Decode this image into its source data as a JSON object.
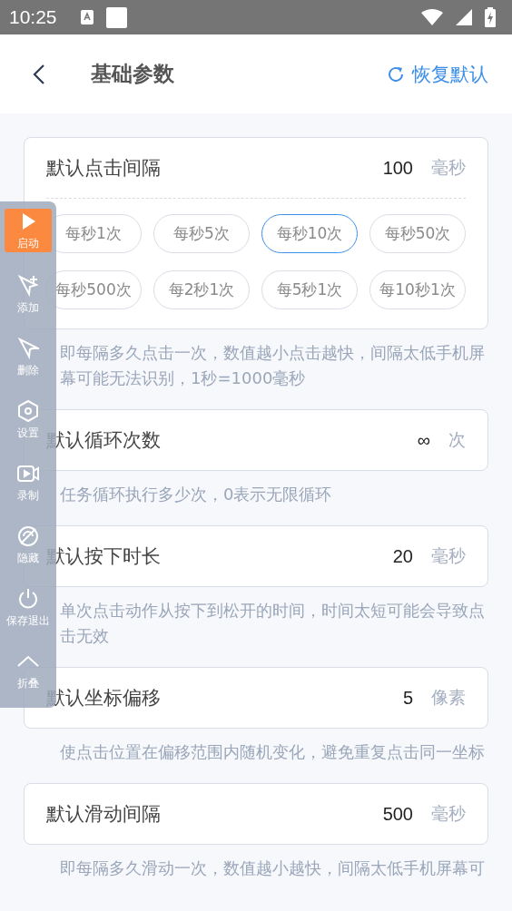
{
  "status_bar": {
    "time": "10:25"
  },
  "header": {
    "title": "基础参数",
    "reset_label": "恢复默认"
  },
  "settings": [
    {
      "label": "默认点击间隔",
      "value": "100",
      "unit": "毫秒",
      "presets": [
        {
          "label": "每秒1次",
          "selected": false
        },
        {
          "label": "每秒5次",
          "selected": false
        },
        {
          "label": "每秒10次",
          "selected": true
        },
        {
          "label": "每秒50次",
          "selected": false
        },
        {
          "label": "每秒500次",
          "selected": false
        },
        {
          "label": "每2秒1次",
          "selected": false
        },
        {
          "label": "每5秒1次",
          "selected": false
        },
        {
          "label": "每10秒1次",
          "selected": false
        }
      ],
      "hint": "即每隔多久点击一次，数值越小点击越快，间隔太低手机屏幕可能无法识别，1秒=1000毫秒"
    },
    {
      "label": "默认循环次数",
      "value": "∞",
      "unit": "次",
      "hint": "任务循环执行多少次，0表示无限循环"
    },
    {
      "label": "默认按下时长",
      "value": "20",
      "unit": "毫秒",
      "hint": "单次点击动作从按下到松开的时间，时间太短可能会导致点击无效"
    },
    {
      "label": "默认坐标偏移",
      "value": "5",
      "unit": "像素",
      "hint": "使点击位置在偏移范围内随机变化，避免重复点击同一坐标"
    },
    {
      "label": "默认滑动间隔",
      "value": "500",
      "unit": "毫秒",
      "hint": "即每隔多久滑动一次，数值越小越快，间隔太低手机屏幕可"
    }
  ],
  "floating_toolbar": {
    "items": [
      {
        "label": "启动",
        "selected": true
      },
      {
        "label": "添加",
        "selected": false
      },
      {
        "label": "删除",
        "selected": false
      },
      {
        "label": "设置",
        "selected": false
      },
      {
        "label": "录制",
        "selected": false
      },
      {
        "label": "隐藏",
        "selected": false
      },
      {
        "label": "保存退出",
        "selected": false
      },
      {
        "label": "折叠",
        "selected": false
      }
    ]
  }
}
